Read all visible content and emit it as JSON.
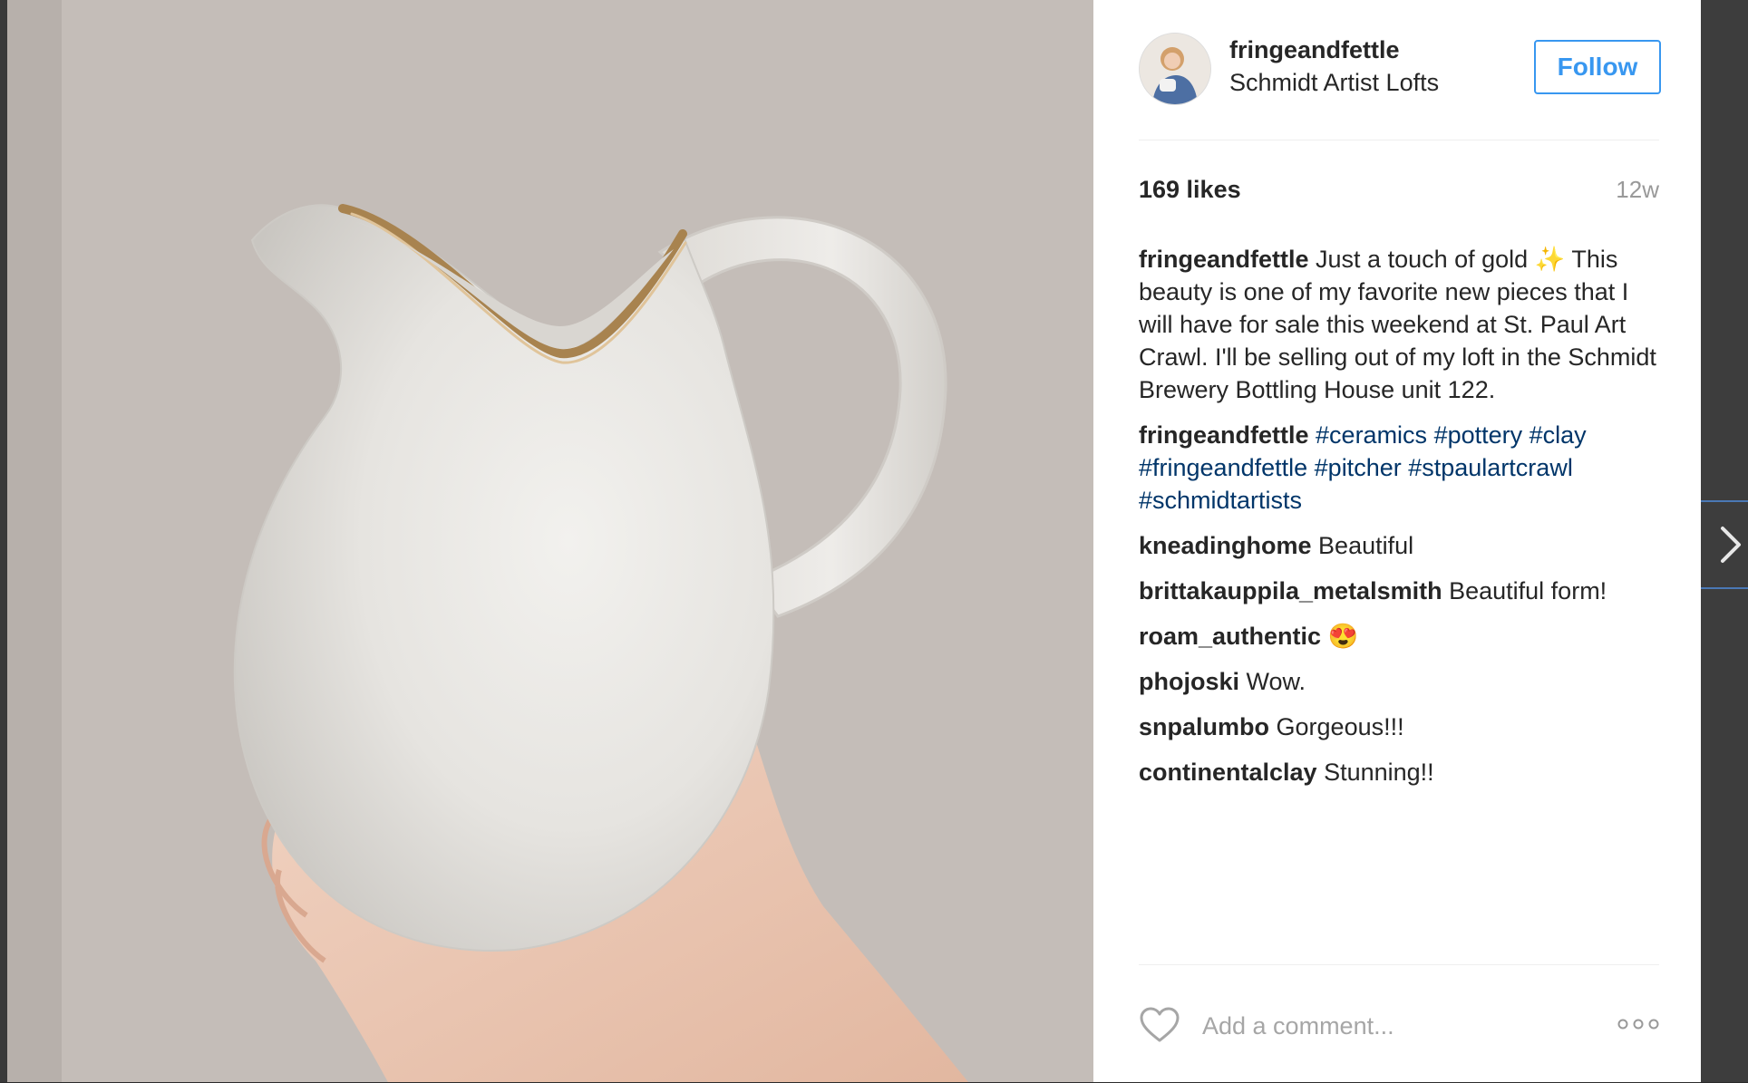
{
  "post": {
    "username": "fringeandfettle",
    "location": "Schmidt Artist Lofts",
    "follow_label": "Follow",
    "likes": "169 likes",
    "age": "12w",
    "caption": {
      "user": "fringeandfettle",
      "text": "Just a touch of gold",
      "emoji": "✨",
      "text2": "This beauty is one of my favorite new pieces that I will have for sale this weekend at St. Paul Art Crawl. I'll be selling out of my loft in the Schmidt Brewery Bottling House unit 122."
    },
    "hashtag_comment": {
      "user": "fringeandfettle",
      "tags": [
        "#ceramics",
        "#pottery",
        "#clay",
        "#fringeandfettle",
        "#pitcher",
        "#stpaulartcrawl",
        "#schmidtartists"
      ]
    },
    "comments": [
      {
        "user": "kneadinghome",
        "text": "Beautiful"
      },
      {
        "user": "brittakauppila_metalsmith",
        "text": "Beautiful form!"
      },
      {
        "user": "roam_authentic",
        "text": "😍"
      },
      {
        "user": "phojoski",
        "text": "Wow."
      },
      {
        "user": "snpalumbo",
        "text": "Gorgeous!!!"
      },
      {
        "user": "continentalclay",
        "text": "Stunning!!"
      }
    ],
    "add_comment_placeholder": "Add a comment...",
    "more_options_glyph": "ooo"
  },
  "icons": {
    "heart": "heart-icon",
    "more": "more-options-icon",
    "next": "chevron-right-icon"
  },
  "colors": {
    "follow_blue": "#3897f0",
    "hashtag_blue": "#003569",
    "text_dark": "#262626",
    "muted": "#999999",
    "nav_border": "#4a78b5"
  }
}
